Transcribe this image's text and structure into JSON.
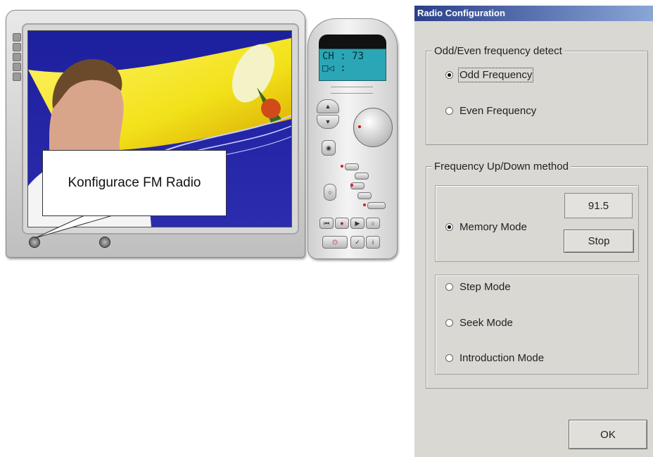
{
  "callout": {
    "text": "Konfigurace FM Radio"
  },
  "remote": {
    "lcd_line1": "CH : 73",
    "lcd_line2": "□◁ :",
    "icons": [
      "lcd-icon",
      "volume-up-icon",
      "volume-down-icon",
      "mute-icon",
      "tuning-dial-icon",
      "prev-icon",
      "record-icon",
      "play-icon",
      "stop-icon",
      "power-icon",
      "check-icon",
      "info-icon"
    ]
  },
  "dialog": {
    "title": "Radio Configuration",
    "group1": {
      "legend": "Odd/Even frequency detect",
      "options": [
        {
          "label": "Odd Frequency",
          "selected": true
        },
        {
          "label": "Even Frequency",
          "selected": false
        }
      ]
    },
    "group2": {
      "legend": "Frequency Up/Down method",
      "memory": {
        "label": "Memory Mode",
        "selected": true,
        "frequency": "91.5",
        "stop_label": "Stop"
      },
      "modes": [
        {
          "label": "Step Mode",
          "selected": false
        },
        {
          "label": "Seek Mode",
          "selected": false
        },
        {
          "label": "Introduction Mode",
          "selected": false
        }
      ]
    },
    "ok_label": "OK"
  },
  "colors": {
    "titlebar": "#2a3f8a",
    "dialog_bg": "#d9d8d3",
    "lcd": "#2aa6b6",
    "video_blue": "#2c2cae",
    "video_yellow": "#f2e21a"
  }
}
